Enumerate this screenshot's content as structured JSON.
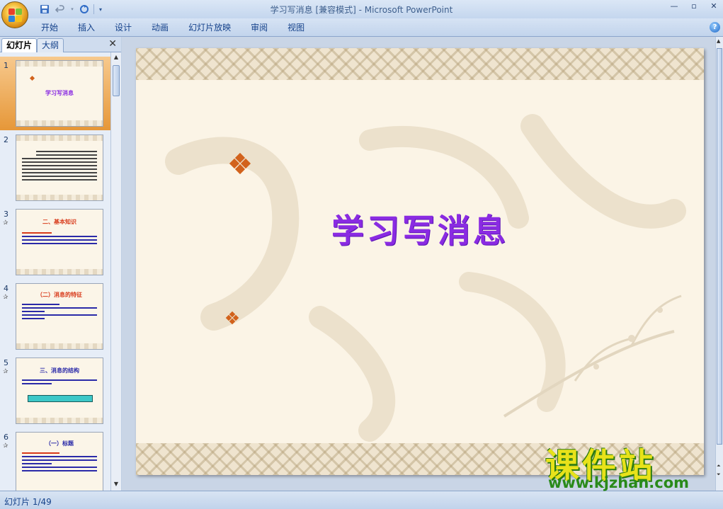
{
  "window": {
    "title": "学习写消息 [兼容模式] - Microsoft PowerPoint"
  },
  "ribbon": {
    "tabs": [
      "开始",
      "插入",
      "设计",
      "动画",
      "幻灯片放映",
      "审阅",
      "视图"
    ]
  },
  "left_panel": {
    "tabs": [
      "幻灯片",
      "大纲"
    ],
    "thumbnails": [
      {
        "number": "1",
        "title": "学习写消息"
      },
      {
        "number": "2",
        "title": ""
      },
      {
        "number": "3",
        "title": "二、基本知识"
      },
      {
        "number": "4",
        "title": "（二）消息的特征"
      },
      {
        "number": "5",
        "title": "三、消息的结构"
      },
      {
        "number": "6",
        "title": "（一）标题"
      }
    ]
  },
  "slide": {
    "title": "学习写消息"
  },
  "status_bar": {
    "slide_info": "幻灯片 1/49"
  },
  "watermark": {
    "cn": "课件站",
    "url": "www.kjzhan.com"
  },
  "colors": {
    "title": "#8a2be2",
    "diamond": "#d2621c",
    "selected_thumb": "#e69738"
  }
}
